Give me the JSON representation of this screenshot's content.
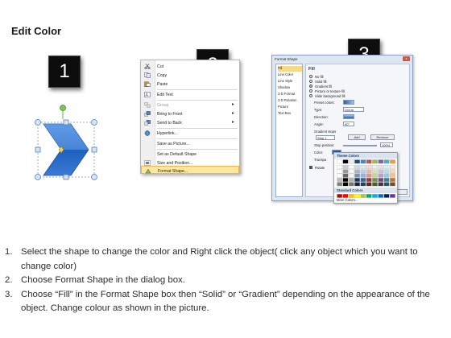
{
  "page": {
    "title": "Edit Color"
  },
  "steps": {
    "step1": "1",
    "step2": "2",
    "step3": "3"
  },
  "context_menu": {
    "items": [
      {
        "label": "Cut",
        "icon": "scissors-icon"
      },
      {
        "label": "Copy",
        "icon": "copy-icon"
      },
      {
        "label": "Paste",
        "icon": "paste-icon"
      },
      {
        "label": "Edit Text",
        "icon": "edit-text-icon"
      },
      {
        "label": "Group",
        "icon": "group-icon",
        "disabled": true,
        "submenu": true
      },
      {
        "label": "Bring to Front",
        "icon": "bring-front-icon",
        "submenu": true
      },
      {
        "label": "Send to Back",
        "icon": "send-back-icon",
        "submenu": true
      },
      {
        "label": "Hyperlink...",
        "icon": "hyperlink-icon"
      },
      {
        "label": "Save as Picture...",
        "icon": ""
      },
      {
        "label": "Set as Default Shape",
        "icon": ""
      },
      {
        "label": "Size and Position...",
        "icon": "size-position-icon"
      },
      {
        "label": "Format Shape...",
        "icon": "format-shape-icon",
        "highlighted": true
      }
    ]
  },
  "format_dialog": {
    "title": "Format Shape",
    "close_label": "x",
    "nav": [
      "Fill",
      "Line Color",
      "Line Style",
      "Shadow",
      "3-D Format",
      "3-D Rotation",
      "Picture",
      "Text Box"
    ],
    "fill_heading": "Fill",
    "fill_options": [
      {
        "label": "No fill",
        "selected": false
      },
      {
        "label": "Solid fill",
        "selected": false
      },
      {
        "label": "Gradient fill",
        "selected": true
      },
      {
        "label": "Picture or texture fill",
        "selected": false
      },
      {
        "label": "Slide background fill",
        "selected": false
      }
    ],
    "preset_colors_label": "Preset colors:",
    "type_label": "Type:",
    "type_value": "Linear",
    "direction_label": "Direction:",
    "angle_label": "Angle:",
    "angle_value": "90°",
    "gradient_stops_label": "Gradient stops",
    "stop_value": "Stop 1",
    "add_label": "Add",
    "remove_label": "Remove",
    "stop_position_label": "Stop position:",
    "stop_position_value": "100%",
    "color_label": "Color:",
    "transparency_label": "Transpa",
    "rotate_label": "Rotate"
  },
  "color_popup": {
    "theme_colors_label": "Theme Colors",
    "standard_colors_label": "Standard Colors",
    "more_colors_label": "More Colors...",
    "theme_colors": [
      "#ffffff",
      "#000000",
      "#eeece1",
      "#1f497d",
      "#4f81bd",
      "#c0504d",
      "#9bbb59",
      "#8064a2",
      "#4bacc6",
      "#f79646"
    ],
    "standard_colors": [
      "#c00000",
      "#ff0000",
      "#ffc000",
      "#ffff00",
      "#92d050",
      "#00b050",
      "#00b0f0",
      "#0070c0",
      "#002060",
      "#7030a0"
    ]
  },
  "instructions": [
    {
      "num": "1.",
      "text": "Select the shape to change the color and Right click the object( click any object which you want to change color)"
    },
    {
      "num": "2.",
      "text": "Choose Format Shape in the dialog box."
    },
    {
      "num": "3.",
      "text": "Choose “Fill” in the Format Shape box then “Solid” or “Gradient” depending on the appearance of the object. Change colour as shown in the picture."
    }
  ]
}
